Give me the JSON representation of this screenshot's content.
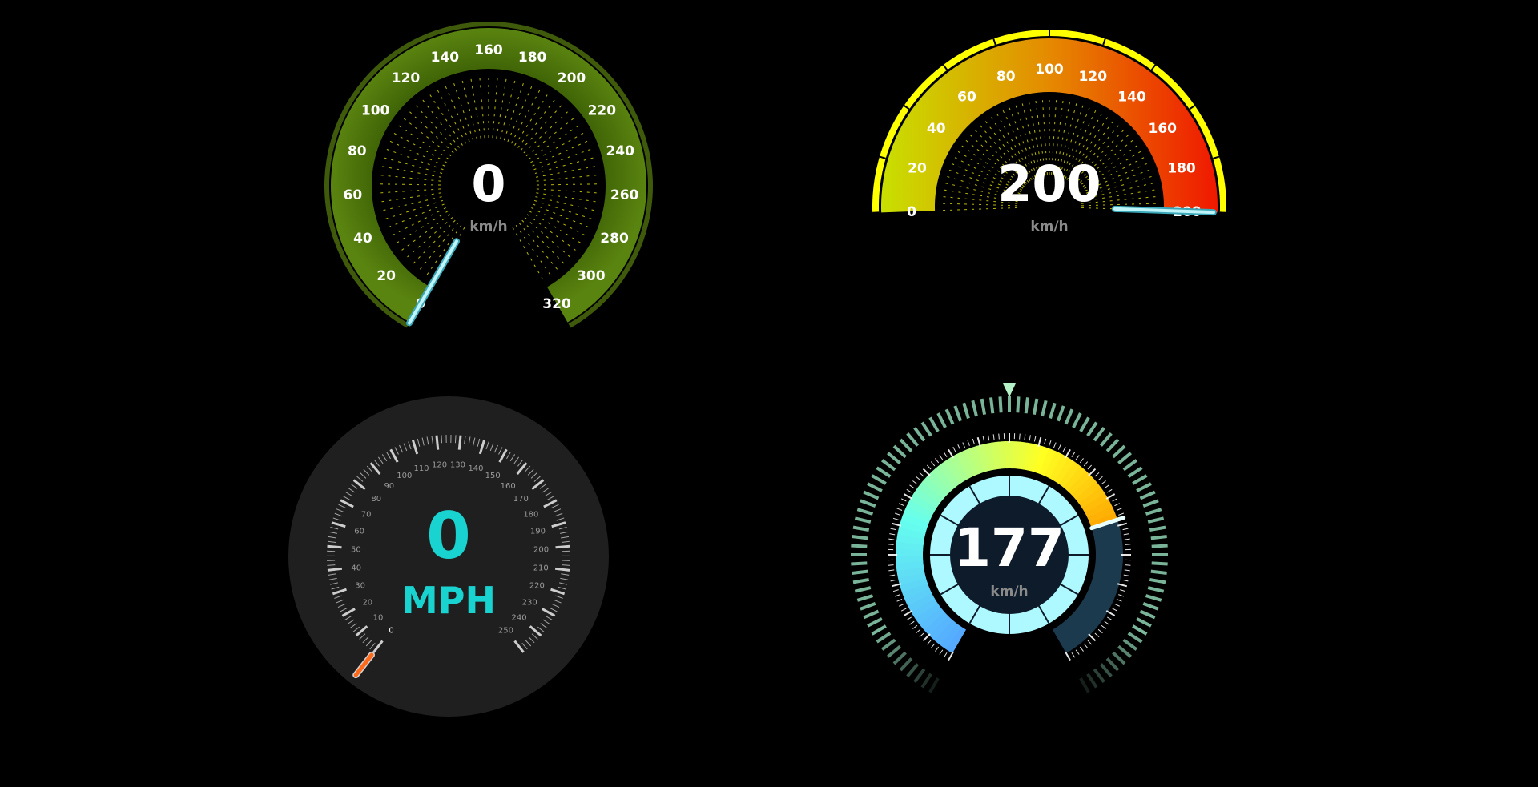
{
  "gauges": [
    {
      "id": "green",
      "value": 0,
      "value_text": "0",
      "unit": "km/h",
      "min": 0,
      "max": 320,
      "tick_labels": [
        "0",
        "20",
        "40",
        "60",
        "80",
        "100",
        "120",
        "140",
        "160",
        "180",
        "200",
        "220",
        "240",
        "260",
        "280",
        "300",
        "320"
      ],
      "colors": {
        "band": "#4f7508",
        "rim": "#3f5a0a",
        "needle": "#bff4f8",
        "ticks": "#e6e600",
        "text": "#ffffff",
        "unit": "#8a8a8a"
      }
    },
    {
      "id": "rainbow",
      "value": 200,
      "value_text": "200",
      "unit": "km/h",
      "min": 0,
      "max": 200,
      "tick_labels": [
        "0",
        "20",
        "40",
        "60",
        "80",
        "100",
        "120",
        "140",
        "160",
        "180",
        "200"
      ],
      "colors": {
        "band_start": "#c8e000",
        "band_mid": "#e58a00",
        "band_end": "#f01800",
        "rim": "#ffff00",
        "needle": "#bff4f8",
        "ticks": "#e6e600",
        "text": "#ffffff",
        "unit": "#8a8a8a"
      }
    },
    {
      "id": "mph",
      "value": 0,
      "value_text": "0",
      "unit": "MPH",
      "min": 0,
      "max": 250,
      "tick_labels": [
        "0",
        "10",
        "20",
        "30",
        "40",
        "50",
        "60",
        "70",
        "80",
        "90",
        "100",
        "110",
        "120",
        "130",
        "140",
        "150",
        "160",
        "170",
        "180",
        "190",
        "200",
        "210",
        "220",
        "230",
        "240",
        "250"
      ],
      "colors": {
        "face": "#1f1f1f",
        "value": "#19d3d0",
        "ticks": "#e0e0e0",
        "labels": "#9a9a9a",
        "needle": "#ff6a1a"
      }
    },
    {
      "id": "cyan",
      "value": 177,
      "value_text": "177",
      "unit": "km/h",
      "fraction": 0.74,
      "colors": {
        "fill_start": "#55aaff",
        "fill_mid": "#66ffee",
        "fill_end": "#ffff22",
        "fill_last": "#ffa500",
        "track": "#1b3a4e",
        "outer": "#8fd4b4",
        "inner": "#aef8ff",
        "center": "#0d1b2a",
        "marker": "#b5f2c8",
        "text": "#ffffff",
        "unit": "#8a8a8a"
      }
    }
  ]
}
